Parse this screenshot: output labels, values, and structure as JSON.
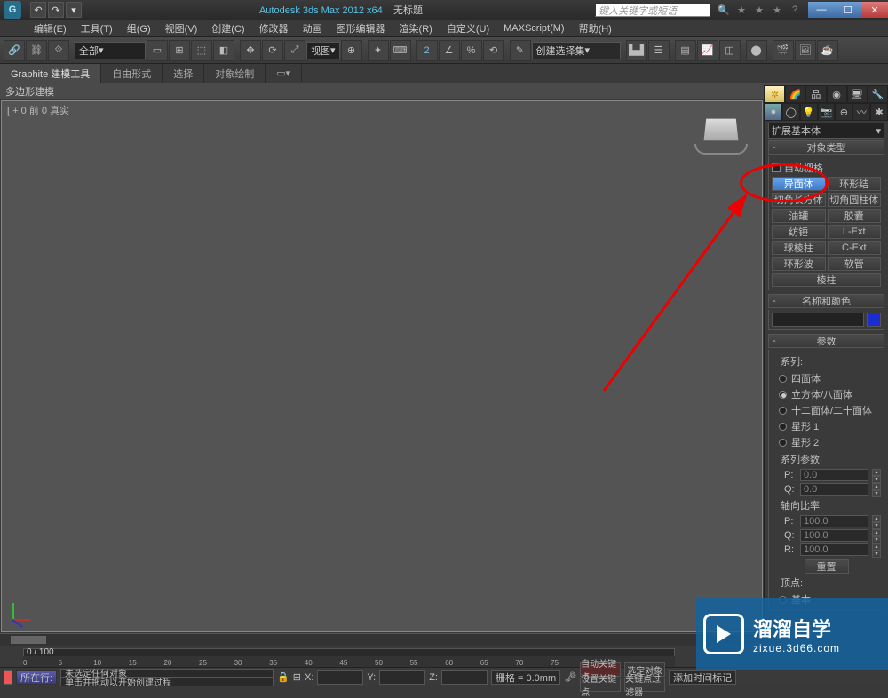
{
  "title": {
    "app": "Autodesk 3ds Max 2012 x64",
    "doc": "无标题"
  },
  "search_placeholder": "键入关键字或短语",
  "menu": [
    "编辑(E)",
    "工具(T)",
    "组(G)",
    "视图(V)",
    "创建(C)",
    "修改器",
    "动画",
    "图形编辑器",
    "渲染(R)",
    "自定义(U)",
    "MAXScript(M)",
    "帮助(H)"
  ],
  "toolbar": {
    "filter": "全部",
    "view_btn": "视图",
    "create_set": "创建选择集"
  },
  "ribbon": {
    "tabs": [
      "Graphite 建模工具",
      "自由形式",
      "选择",
      "对象绘制"
    ],
    "sub": "多边形建模"
  },
  "viewport_label": "[ + 0 前 0 真实",
  "cmd": {
    "dropdown": "扩展基本体",
    "roll_obj_type": "对象类型",
    "autogrid": "自动栅格",
    "buttons": [
      "异面体",
      "环形结",
      "切角长方体",
      "切角圆柱体",
      "油罐",
      "胶囊",
      "纺锤",
      "L-Ext",
      "球棱柱",
      "C-Ext",
      "环形波",
      "软管",
      "棱柱"
    ],
    "roll_name": "名称和颜色",
    "roll_params": "参数",
    "series_label": "系列:",
    "series": [
      "四面体",
      "立方体/八面体",
      "十二面体/二十面体",
      "星形 1",
      "星形 2"
    ],
    "series_params_label": "系列参数:",
    "p_label": "P:",
    "p_val": "0.0",
    "q_label": "Q:",
    "q_val": "0.0",
    "axis_ratio_label": "轴向比率:",
    "pr_label": "P:",
    "pr_val": "100.0",
    "qr_label": "Q:",
    "qr_val": "100.0",
    "rr_label": "R:",
    "rr_val": "100.0",
    "reset": "重置",
    "vertex_label": "顶点:",
    "basic_label": "基本"
  },
  "time": {
    "pos": "0 / 100",
    "ticks": [
      0,
      5,
      10,
      15,
      20,
      25,
      30,
      35,
      40,
      45,
      50,
      55,
      60,
      65,
      70,
      75
    ]
  },
  "status": {
    "sel": "未选定任何对象",
    "prompt": "单击并拖动以开始创建过程",
    "x": "X:",
    "y": "Y:",
    "z": "Z:",
    "grid": "栅格 = 0.0mm",
    "autokey": "自动关键点",
    "setkey": "设置关键点",
    "selfilter": "选定对象",
    "keyfilter": "关键点过滤器",
    "add_marker": "添加时间标记",
    "inplace": "所在行:"
  },
  "watermark": {
    "big": "溜溜自学",
    "small": "zixue.3d66.com"
  }
}
